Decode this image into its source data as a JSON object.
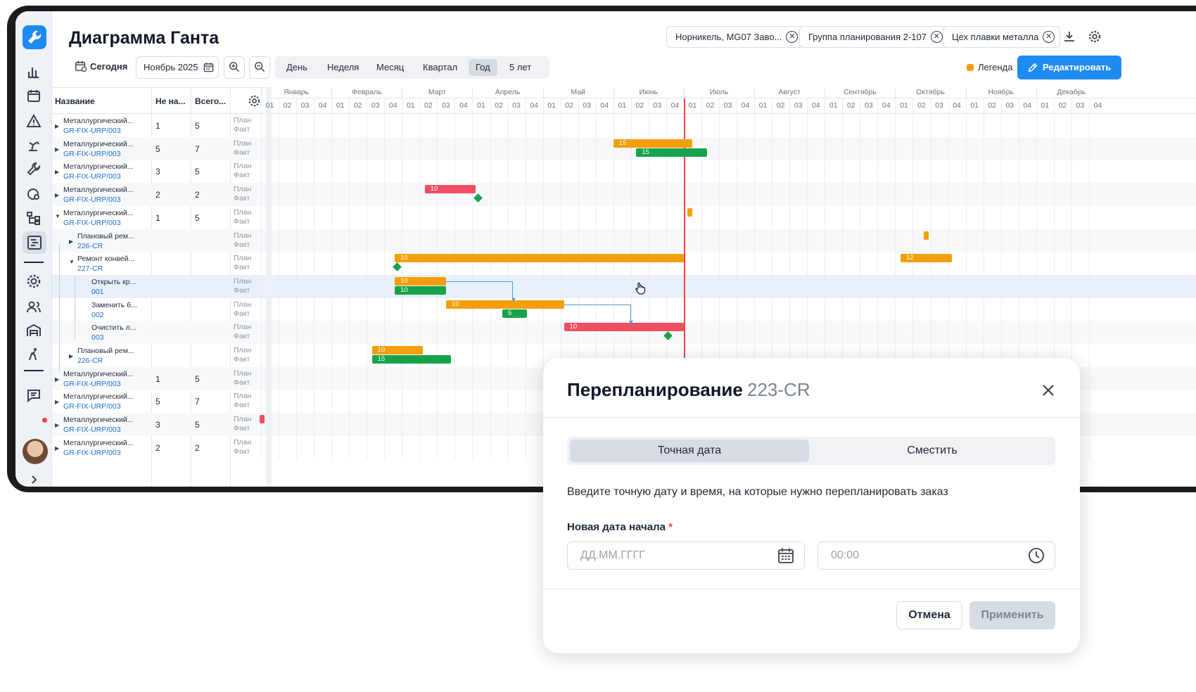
{
  "header": {
    "title": "Диаграмма Ганта",
    "filters": [
      "Норникель, MG07 Заво...",
      "Группа планирования 2-107",
      "Цех плавки металла"
    ]
  },
  "toolbar": {
    "today": "Сегодня",
    "date": "Ноябрь 2025",
    "scales": [
      "День",
      "Неделя",
      "Месяц",
      "Квартал",
      "Год",
      "5 лет"
    ],
    "selected_scale": "Год",
    "legend": "Легенда",
    "edit": "Редактировать"
  },
  "table": {
    "columns": [
      "Название",
      "Не на...",
      "Всего..."
    ],
    "plan": "План",
    "fact": "Факт",
    "rows": [
      {
        "n1": "Металлургический...",
        "n2": "GR-FIX-URP/003",
        "a": "1",
        "b": "5",
        "level": 0,
        "caret": "right"
      },
      {
        "n1": "Металлургический...",
        "n2": "GR-FIX-URP/003",
        "a": "5",
        "b": "7",
        "level": 0,
        "caret": "right"
      },
      {
        "n1": "Металлургический...",
        "n2": "GR-FIX-URP/003",
        "a": "3",
        "b": "5",
        "level": 0,
        "caret": "right"
      },
      {
        "n1": "Металлургический...",
        "n2": "GR-FIX-URP/003",
        "a": "2",
        "b": "2",
        "level": 0,
        "caret": "right"
      },
      {
        "n1": "Металлургический...",
        "n2": "GR-FIX-URP/003",
        "a": "1",
        "b": "5",
        "level": 0,
        "caret": "down"
      },
      {
        "n1": "Плановый рем...",
        "n2": "226-CR",
        "a": "",
        "b": "",
        "level": 1,
        "caret": "right"
      },
      {
        "n1": "Ремонт конвей...",
        "n2": "227-CR",
        "a": "",
        "b": "",
        "level": 1,
        "caret": "down"
      },
      {
        "n1": "Открыть кр...",
        "n2": "001",
        "a": "",
        "b": "",
        "level": 2,
        "caret": ""
      },
      {
        "n1": "Заменить б...",
        "n2": "002",
        "a": "",
        "b": "",
        "level": 2,
        "caret": ""
      },
      {
        "n1": "Очистить л...",
        "n2": "003",
        "a": "",
        "b": "",
        "level": 2,
        "caret": ""
      },
      {
        "n1": "Плановый рем...",
        "n2": "226-CR",
        "a": "",
        "b": "",
        "level": 1,
        "caret": "right"
      },
      {
        "n1": "Металлургический...",
        "n2": "GR-FIX-URP/003",
        "a": "1",
        "b": "5",
        "level": 0,
        "caret": "right"
      },
      {
        "n1": "Металлургический...",
        "n2": "GR-FIX-URP/003",
        "a": "5",
        "b": "7",
        "level": 0,
        "caret": "right"
      },
      {
        "n1": "Металлургический...",
        "n2": "GR-FIX-URP/003",
        "a": "3",
        "b": "5",
        "level": 0,
        "caret": "right"
      },
      {
        "n1": "Металлургический...",
        "n2": "GR-FIX-URP/003",
        "a": "2",
        "b": "2",
        "level": 0,
        "caret": "right"
      }
    ]
  },
  "gantt": {
    "months": [
      "Январь",
      "Февраль",
      "Март",
      "Апрель",
      "Май",
      "Июнь",
      "Июль",
      "Август",
      "Сентябрь",
      "Октябрь",
      "Ноябрь",
      "Декабрь"
    ],
    "weeks": [
      "01",
      "02",
      "03",
      "04"
    ],
    "today_week": 24,
    "bars": [
      {
        "row": 1,
        "kind": "plan",
        "start": 20,
        "end": 24.5,
        "label": "15",
        "color": "orange"
      },
      {
        "row": 1,
        "kind": "fact",
        "start": 21.3,
        "end": 25.3,
        "label": "15",
        "color": "green"
      },
      {
        "row": 3,
        "kind": "plan",
        "start": 9.3,
        "end": 12.2,
        "label": "10",
        "color": "red"
      },
      {
        "row": 4,
        "kind": "plan",
        "start": 24.2,
        "end": 24.5,
        "label": "",
        "color": "orange"
      },
      {
        "row": 5,
        "kind": "plan",
        "start": 37.6,
        "end": 37.9,
        "label": "",
        "color": "orange"
      },
      {
        "row": 6,
        "kind": "plan",
        "start": 7.6,
        "end": 24,
        "label": "10",
        "color": "orange"
      },
      {
        "row": 6,
        "kind": "plan",
        "start": 36.3,
        "end": 39.2,
        "label": "12",
        "color": "orange"
      },
      {
        "row": 7,
        "kind": "plan",
        "start": 7.6,
        "end": 10.5,
        "label": "10",
        "color": "orange"
      },
      {
        "row": 7,
        "kind": "fact",
        "start": 7.6,
        "end": 10.5,
        "label": "10",
        "color": "green"
      },
      {
        "row": 8,
        "kind": "plan",
        "start": 10.5,
        "end": 17.2,
        "label": "10",
        "color": "orange"
      },
      {
        "row": 8,
        "kind": "fact",
        "start": 13.7,
        "end": 15.1,
        "label": "5",
        "color": "green"
      },
      {
        "row": 9,
        "kind": "plan",
        "start": 17.2,
        "end": 24,
        "label": "10",
        "color": "red"
      },
      {
        "row": 10,
        "kind": "plan",
        "start": 6.3,
        "end": 9.2,
        "label": "10",
        "color": "orange"
      },
      {
        "row": 10,
        "kind": "fact",
        "start": 6.3,
        "end": 10.8,
        "label": "15",
        "color": "green"
      },
      {
        "row": 13,
        "kind": "plan",
        "start": -0.1,
        "end": 0.2,
        "label": "",
        "color": "red"
      }
    ],
    "milestones": [
      {
        "row": 3,
        "week": 12.3
      },
      {
        "row": 6,
        "week": 7.7
      },
      {
        "row": 9,
        "week": 23.1
      }
    ]
  },
  "modal": {
    "title": "Перепланирование",
    "code": "223-CR",
    "tabs": [
      "Точная дата",
      "Сместить"
    ],
    "selected_tab": "Точная дата",
    "description": "Введите точную дату и время, на которые нужно перепланировать заказ",
    "date_label": "Новая дата начала",
    "required_mark": "*",
    "date_placeholder": "ДД.ММ.ГГГГ",
    "time_placeholder": "00:00",
    "cancel": "Отмена",
    "apply": "Применить"
  },
  "colors": {
    "orange": "#f59e0b",
    "green": "#16a34a",
    "red": "#ef4f5f",
    "accent": "#1d8bf1",
    "today": "#ef4444"
  }
}
